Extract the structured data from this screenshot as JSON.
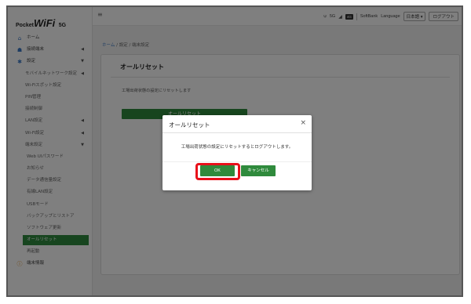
{
  "logo": {
    "small": "Pocket",
    "big": "WiFi",
    "version": "5G"
  },
  "sidebar": {
    "items": [
      {
        "label": "ホーム",
        "icon": "home-icon"
      },
      {
        "label": "接続端末",
        "icon": "devices-icon"
      },
      {
        "label": "設定",
        "icon": "gear-icon"
      },
      {
        "label": "モバイルネットワーク設定"
      },
      {
        "label": "Wi-Fiスポット設定"
      },
      {
        "label": "PIN管理"
      },
      {
        "label": "接続制御"
      },
      {
        "label": "LAN設定"
      },
      {
        "label": "Wi-Fi設定"
      },
      {
        "label": "端末設定"
      },
      {
        "label": "Web UIパスワード"
      },
      {
        "label": "お知らせ"
      },
      {
        "label": "データ通信量設定"
      },
      {
        "label": "有線LAN設定"
      },
      {
        "label": "USBモード"
      },
      {
        "label": "バックアップとリストア"
      },
      {
        "label": "ソフトウェア更新"
      },
      {
        "label": "オールリセット"
      },
      {
        "label": "再起動"
      },
      {
        "label": "端末情報",
        "icon": "info-icon"
      }
    ]
  },
  "topbar": {
    "network": "5G",
    "badge": "4G",
    "carrier": "SoftBank",
    "language_label": "Language",
    "language_value": "日本語",
    "logout": "ログアウト"
  },
  "breadcrumb": {
    "home": "ホーム",
    "sep": " / ",
    "settings": "設定",
    "device": "端末設定"
  },
  "card": {
    "title": "オールリセット",
    "description": "工場出荷状態の設定にリセットします",
    "reset_button": "オールリセット"
  },
  "modal": {
    "title": "オールリセット",
    "close": "×",
    "message": "工場出荷状態の設定にリセットするとログアウトします。",
    "ok": "OK",
    "cancel": "キャンセル"
  },
  "colors": {
    "accent": "#2f8a3c",
    "highlight": "#e8101a",
    "link": "#3b78c4"
  }
}
